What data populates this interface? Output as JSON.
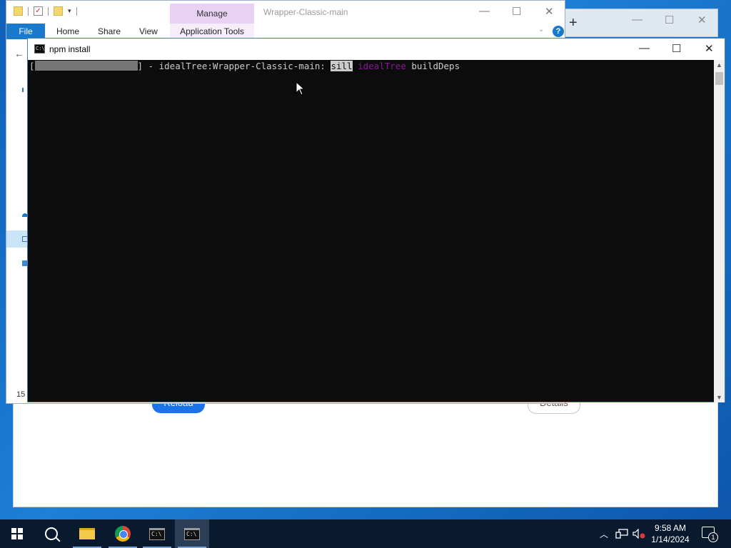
{
  "explorer": {
    "title": "Wrapper-Classic-main",
    "manage_tab": "Manage",
    "ribbon_tabs": [
      "File",
      "Home",
      "Share",
      "View",
      "Application Tools"
    ],
    "help_label": "?",
    "item_count": "15"
  },
  "browser": {
    "reload_label": "Reload",
    "details_label": "Details"
  },
  "terminal": {
    "title": "npm install",
    "line_prefix": "[",
    "line_mid": "] - idealTree:Wrapper-Classic-main: ",
    "level": "sill",
    "tag": "idealTree",
    "message": "buildDeps",
    "progress_filled": 1.0
  },
  "taskbar": {
    "time": "9:58 AM",
    "date": "1/14/2024",
    "notification_count": "1"
  },
  "colors": {
    "terminal_bg": "#0c0c0c",
    "terminal_text": "#cccccc",
    "tag_purple": "#881798",
    "manage_tab": "#e8d1f3",
    "file_tab": "#1979ca",
    "taskbar": "#0a1a2e"
  },
  "icons": [
    "folder-icon",
    "properties-icon",
    "new-folder-icon",
    "back-arrow-icon",
    "cmd-icon",
    "minimize-icon",
    "maximize-icon",
    "close-icon",
    "start-icon",
    "search-icon",
    "file-explorer-icon",
    "chrome-icon",
    "terminal-icon",
    "chevron-up-icon",
    "network-icon",
    "volume-muted-icon",
    "notification-icon"
  ]
}
